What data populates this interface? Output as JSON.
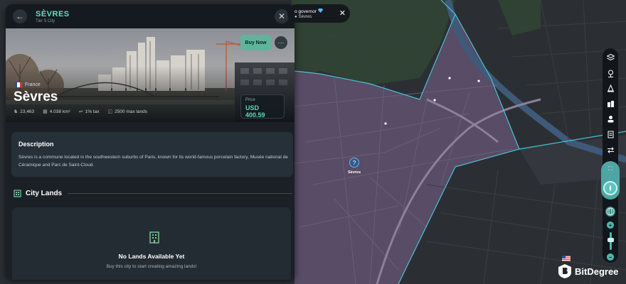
{
  "panel": {
    "header": {
      "title": "SÈVRES",
      "subtitle": "Tier 5 City"
    },
    "hero": {
      "country": "France",
      "city_name": "Sèvres",
      "stats": {
        "population": "23,463",
        "area": "4.038 km²",
        "tax": "1% tax",
        "max_lands": "2500 max lands"
      },
      "buy_label": "Buy Now",
      "more_label": "···",
      "price_label": "Price",
      "price_value": "USD 400.59"
    },
    "description": {
      "title": "Description",
      "text": "Sèvres is a commune located in the southwestern suburbs of Paris, known for its world-famous porcelain factory, Musée national de Céramique and Parc de Saint-Cloud."
    },
    "city_lands": {
      "title": "City Lands",
      "empty_title": "No Lands Available Yet",
      "empty_subtitle": "Buy this city to start creating amazing lands!"
    }
  },
  "governor_bar": {
    "line1": "o governor",
    "line2": "Sèvres"
  },
  "map": {
    "marker_label": "Sèvres",
    "marker_symbol": "?"
  },
  "watermark": {
    "text": "BitDegree"
  },
  "colors": {
    "accent": "#5ee0c6",
    "buy": "#5fb59c",
    "boundary": "#4cc0d8",
    "land": "#5a4e68"
  },
  "icons": [
    "back-arrow-icon",
    "close-icon",
    "population-icon",
    "area-icon",
    "tax-icon",
    "lands-icon",
    "building-icon",
    "compass-icon",
    "globe-icon",
    "zoom-in-icon",
    "zoom-out-icon",
    "diamond-icon"
  ]
}
